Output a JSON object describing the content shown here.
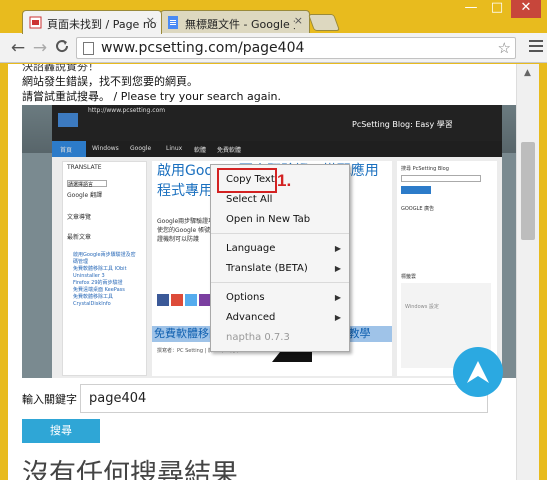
{
  "tabs": [
    {
      "title": "頁面未找到 / Page not fo",
      "close": "×"
    },
    {
      "title": "無標題文件 - Google 文件",
      "close": "×"
    }
  ],
  "window_controls": {
    "minimize": "—",
    "maximize": "□",
    "close": "✕"
  },
  "toolbar": {
    "back": "←",
    "forward": "→",
    "reload": "C",
    "url": "www.pcsetting.com/page404",
    "star": "☆"
  },
  "page": {
    "top_cut_text": "決詔轟說實夯！",
    "error_line1": "網站發生錯誤，找不到您要的網頁。",
    "error_line2": "請嘗試重試搜尋。 / Please try your search again.",
    "keyword_label": "輸入關鍵字",
    "keyword_value": "page404",
    "search_button": "搜尋",
    "big_text": "沒有任何搜尋結果"
  },
  "screenshot": {
    "url": "http://www.pcsetting.com",
    "blog_title": "PcSetting Blog: Easy 學習",
    "nav": [
      "首頁",
      "Windows",
      "Google",
      "Linux",
      "軟體",
      "免費軟體"
    ],
    "translate_title": "TRANSLATE",
    "select_language": "請選擇語言",
    "powered": "Google 翻譯",
    "toc_title": "文章導覽",
    "toc_sub": "最新文章",
    "links": [
      "啟用Google兩步驟驗證及密碼管理",
      "免費軟體移除工具 IObit Uninstaller 3",
      "Firefox 29的兩步驗證",
      "免費遠端桌面 KeePass",
      "免費軟體移除工具 CrystalDiskInfo"
    ],
    "heading": "啟用Google 兩步驟驗證 - 搭配應用程式專用密碼教學",
    "body_text": "Google兩步驟驗證功能是一種保護帳號的機制，即使您的Google 帳號密碼被竊取，也會有兩步驟的驗證機制可以防護",
    "selected_title": "免費軟體移除工具 IObit Uninstaller 3 教學",
    "meta": "撰寫者：PC Setting | 於 12 / 4 月 / 2014",
    "search_blog": "搜尋 PcSetting Blog",
    "google_ads": "GOOGLE 廣告",
    "tags": "標籤雲",
    "windows_label": "Windows 設定"
  },
  "context_menu": {
    "items": [
      {
        "label": "Copy Text",
        "submenu": false,
        "dim": false
      },
      {
        "label": "Select All",
        "submenu": false,
        "dim": false
      },
      {
        "label": "Open in New Tab",
        "submenu": false,
        "dim": false
      },
      {
        "label": "Language",
        "submenu": true,
        "dim": false
      },
      {
        "label": "Translate (BETA)",
        "submenu": true,
        "dim": false
      },
      {
        "label": "Options",
        "submenu": true,
        "dim": false
      },
      {
        "label": "Advanced",
        "submenu": true,
        "dim": false
      },
      {
        "label": "naptha 0.7.3",
        "submenu": false,
        "dim": true
      }
    ],
    "step_marker": "1."
  },
  "colors": {
    "window_frame": "#e8bb1e",
    "highlight": "#d32222",
    "accent": "#2ba9e1"
  }
}
